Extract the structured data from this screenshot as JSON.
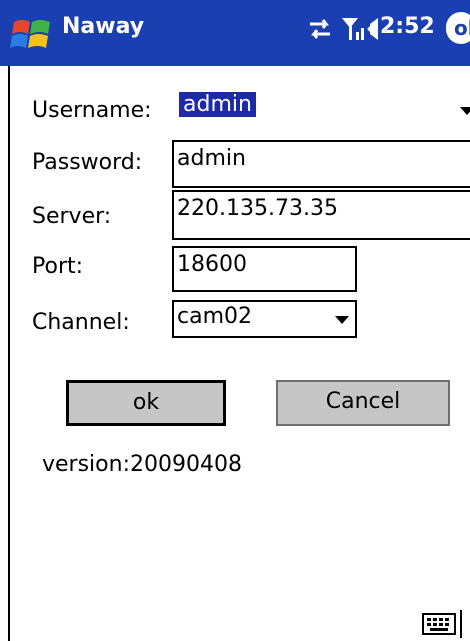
{
  "window": {
    "app_title": "Naway",
    "clock": "2:52",
    "ok_label": "ok"
  },
  "form": {
    "username": {
      "label": "Username:",
      "value": "admin"
    },
    "password": {
      "label": "Password:",
      "value": "admin"
    },
    "server": {
      "label": "Server:",
      "value": "220.135.73.35"
    },
    "port": {
      "label": "Port:",
      "value": "18600"
    },
    "channel": {
      "label": "Channel:",
      "value": "cam02"
    }
  },
  "buttons": {
    "ok": "ok",
    "cancel": "Cancel"
  },
  "version": "version:20090408",
  "icons": [
    "windows-start-icon",
    "sync-icon",
    "signal-icon",
    "volume-icon",
    "keyboard-icon"
  ],
  "colors": {
    "titlebar": "#1a3fb0",
    "selection": "#1c2aa8",
    "button": "#c6c6c6"
  }
}
